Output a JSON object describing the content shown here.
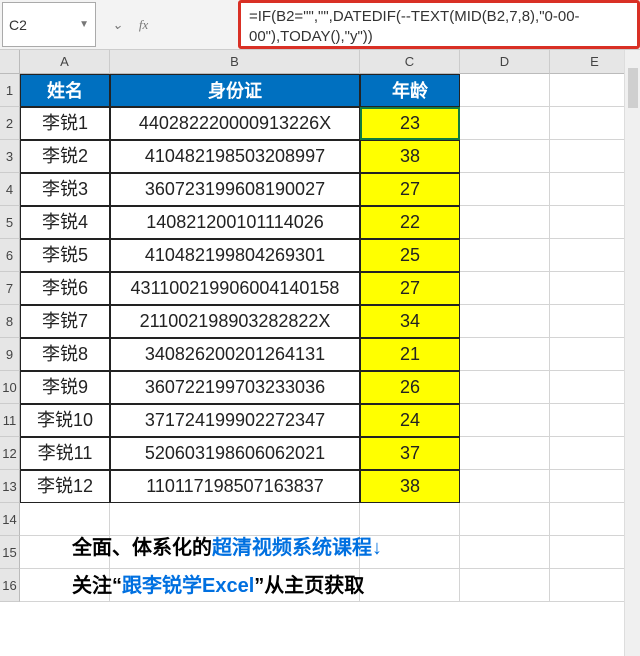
{
  "name_box": "C2",
  "formula": "=IF(B2=\"\",\"\",DATEDIF(--TEXT(MID(B2,7,8),\"0-00-00\"),TODAY(),\"y\"))",
  "columns": [
    "A",
    "B",
    "C",
    "D",
    "E"
  ],
  "headers": {
    "A": "姓名",
    "B": "身份证",
    "C": "年龄"
  },
  "rows": [
    {
      "n": "1"
    },
    {
      "n": "2",
      "A": "李锐1",
      "B": "440282220000913226X",
      "C": "23"
    },
    {
      "n": "3",
      "A": "李锐2",
      "B": "410482198503208997",
      "C": "38"
    },
    {
      "n": "4",
      "A": "李锐3",
      "B": "360723199608190027",
      "C": "27"
    },
    {
      "n": "5",
      "A": "李锐4",
      "B": "140821200101114026",
      "C": "22"
    },
    {
      "n": "6",
      "A": "李锐5",
      "B": "410482199804269301",
      "C": "25"
    },
    {
      "n": "7",
      "A": "李锐6",
      "B": "431100219906004140158",
      "C": "27"
    },
    {
      "n": "8",
      "A": "李锐7",
      "B": "211002198903282822X",
      "C": "34"
    },
    {
      "n": "9",
      "A": "李锐8",
      "B": "340826200201264131",
      "C": "21"
    },
    {
      "n": "10",
      "A": "李锐9",
      "B": "360722199703233036",
      "C": "26"
    },
    {
      "n": "11",
      "A": "李锐10",
      "B": "371724199902272347",
      "C": "24"
    },
    {
      "n": "12",
      "A": "李锐11",
      "B": "520603198606062021",
      "C": "37"
    },
    {
      "n": "13",
      "A": "李锐12",
      "B": "110117198507163837",
      "C": "38"
    },
    {
      "n": "14"
    },
    {
      "n": "15"
    },
    {
      "n": "16"
    }
  ],
  "promo": {
    "line1_black1": "全面、体系化的",
    "line1_blue": "超清视频系统课程↓",
    "line2_black1": "关注“",
    "line2_blue": "跟李锐学Excel",
    "line2_black2": "”从主页获取"
  },
  "active_cell": "C2"
}
